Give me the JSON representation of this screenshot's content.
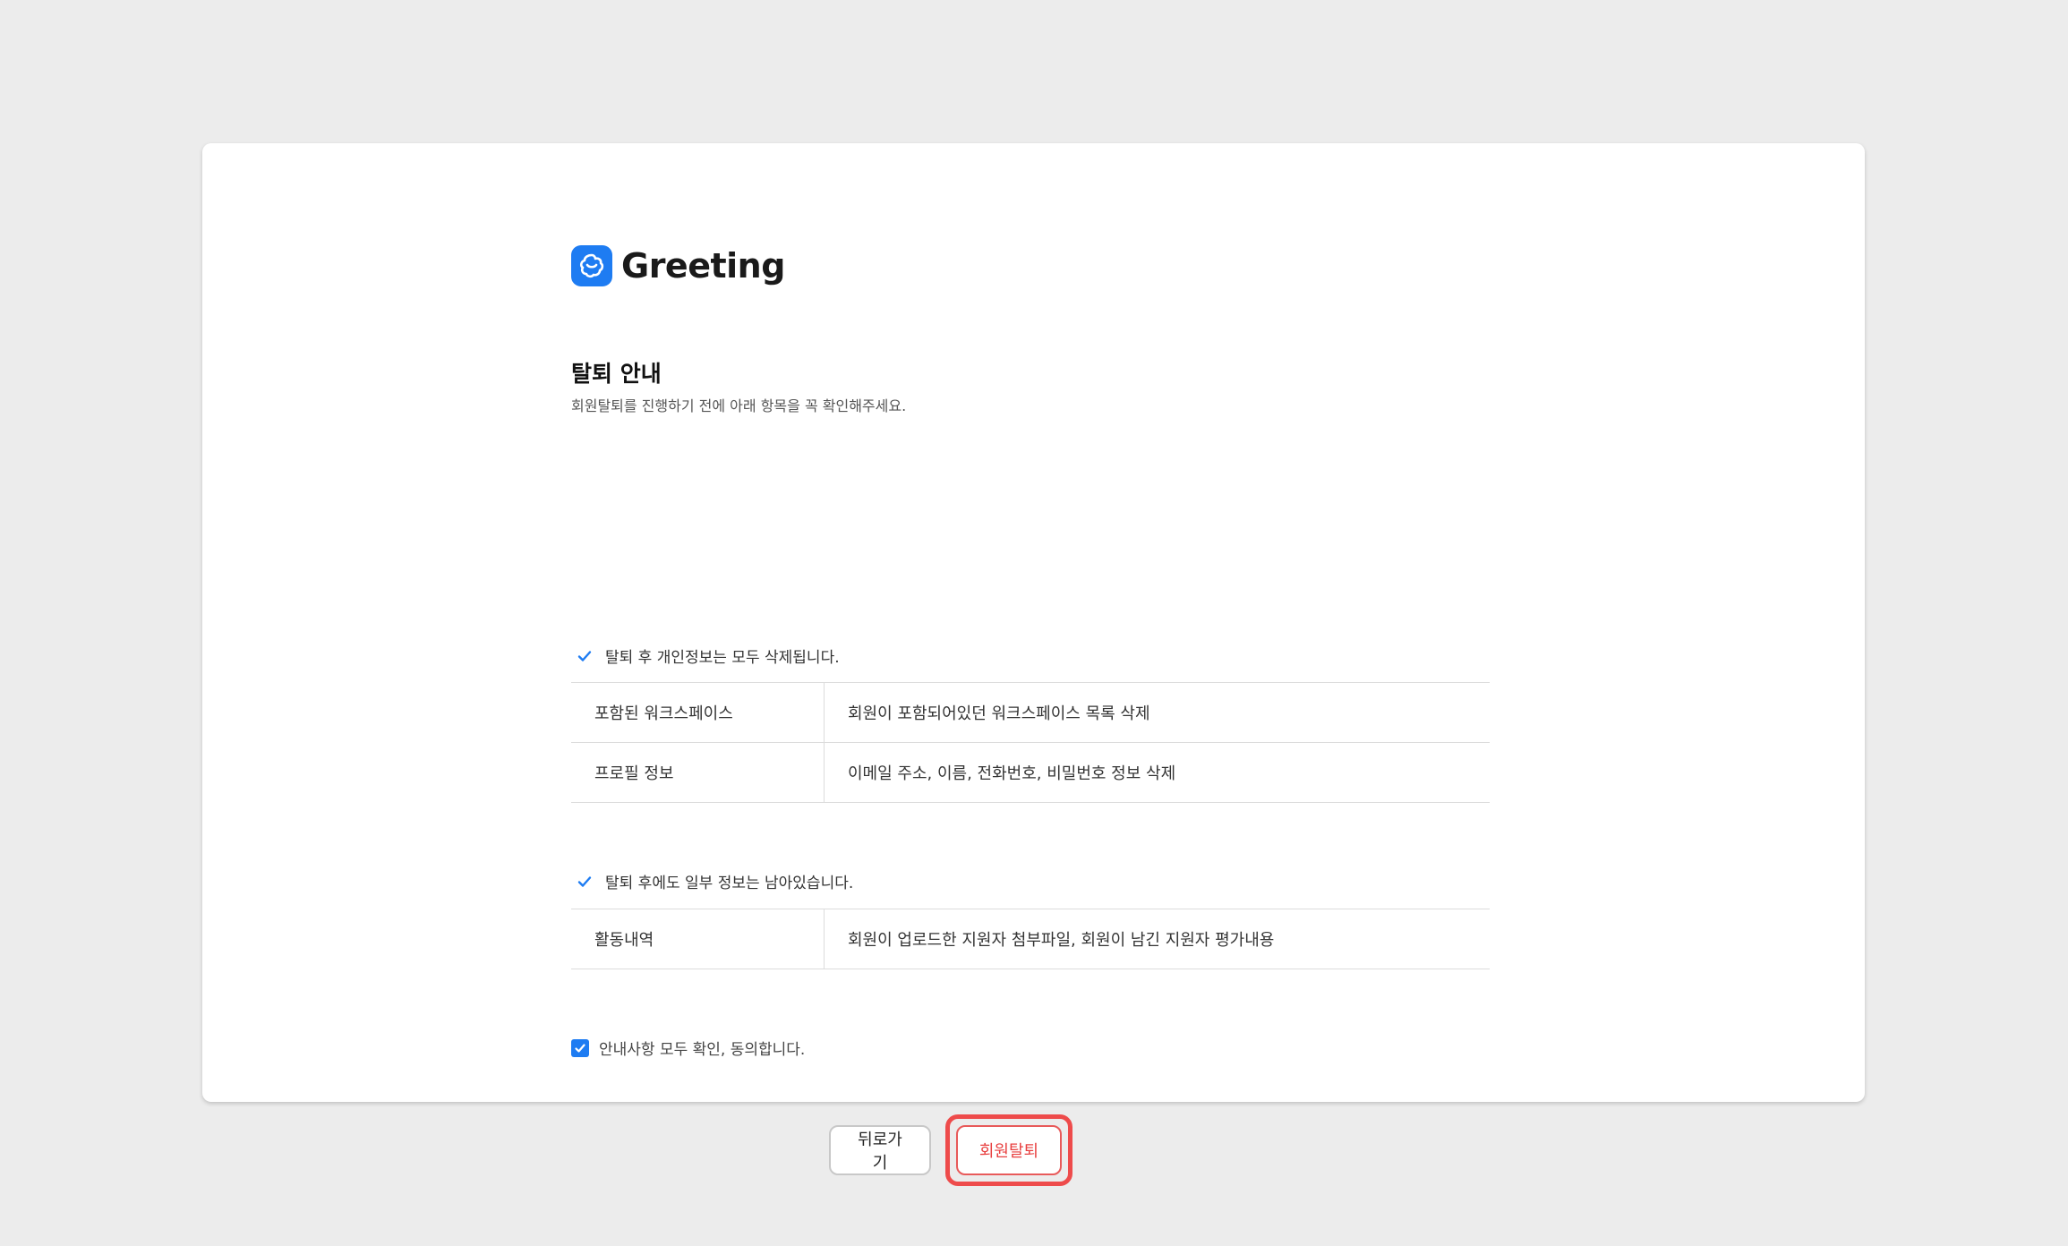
{
  "brand": {
    "name": "Greeting",
    "color": "#1e7cf2"
  },
  "page": {
    "title": "탈퇴 안내",
    "subtitle": "회원탈퇴를 진행하기 전에 아래 항목을 꼭 확인해주세요."
  },
  "sections": [
    {
      "title": "탈퇴 후 개인정보는 모두 삭제됩니다.",
      "rows": [
        {
          "label": "포함된 워크스페이스",
          "value": "회원이 포함되어있던 워크스페이스 목록 삭제"
        },
        {
          "label": "프로필 정보",
          "value": "이메일 주소, 이름, 전화번호, 비밀번호 정보 삭제"
        }
      ]
    },
    {
      "title": "탈퇴 후에도 일부 정보는 남아있습니다.",
      "rows": [
        {
          "label": "활동내역",
          "value": "회원이 업로드한 지원자 첨부파일, 회원이 남긴 지원자 평가내용"
        }
      ]
    }
  ],
  "agreement": {
    "label": "안내사항 모두 확인, 동의합니다.",
    "checked": true
  },
  "actions": {
    "back_label": "뒤로가기",
    "withdraw_label": "회원탈퇴",
    "highlight_color": "#ee4b4b"
  }
}
